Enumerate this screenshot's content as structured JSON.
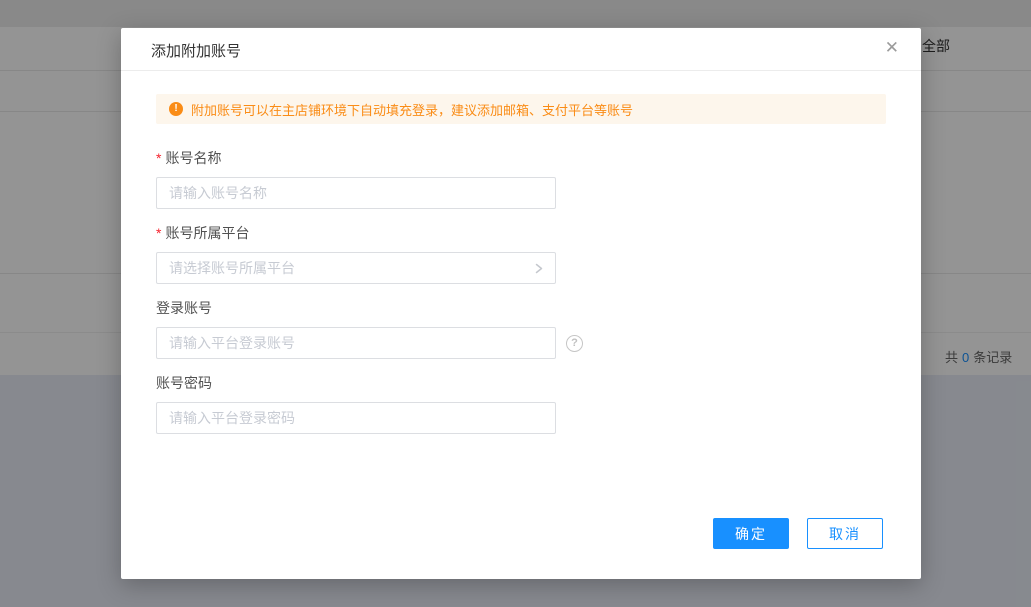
{
  "dialog": {
    "title": "添加附加账号",
    "close_glyph": "✕",
    "notice_icon_glyph": "!",
    "notice": "附加账号可以在主店铺环境下自动填充登录，建议添加邮箱、支付平台等账号",
    "required_mark": "*",
    "fields": [
      {
        "label": "账号名称",
        "required": true,
        "type": "input",
        "placeholder": "请输入账号名称"
      },
      {
        "label": "账号所属平台",
        "required": true,
        "type": "select",
        "placeholder": "请选择账号所属平台"
      },
      {
        "label": "登录账号",
        "required": false,
        "type": "input",
        "placeholder": "请输入平台登录账号",
        "has_help": true
      },
      {
        "label": "账号密码",
        "required": false,
        "type": "input",
        "placeholder": "请输入平台登录密码"
      }
    ],
    "help_glyph": "?",
    "confirm_label": "确定",
    "cancel_label": "取消"
  },
  "background": {
    "filter_all_label": "全部",
    "total": {
      "prefix": "共",
      "count": "0",
      "suffix": "条记录"
    }
  },
  "colors": {
    "accent_blue": "#1890ff",
    "warning_orange": "#fa8c16",
    "warning_bg": "#fdf6ec",
    "required_red": "#f5222d",
    "mask": "rgba(0,0,0,0.42)"
  }
}
